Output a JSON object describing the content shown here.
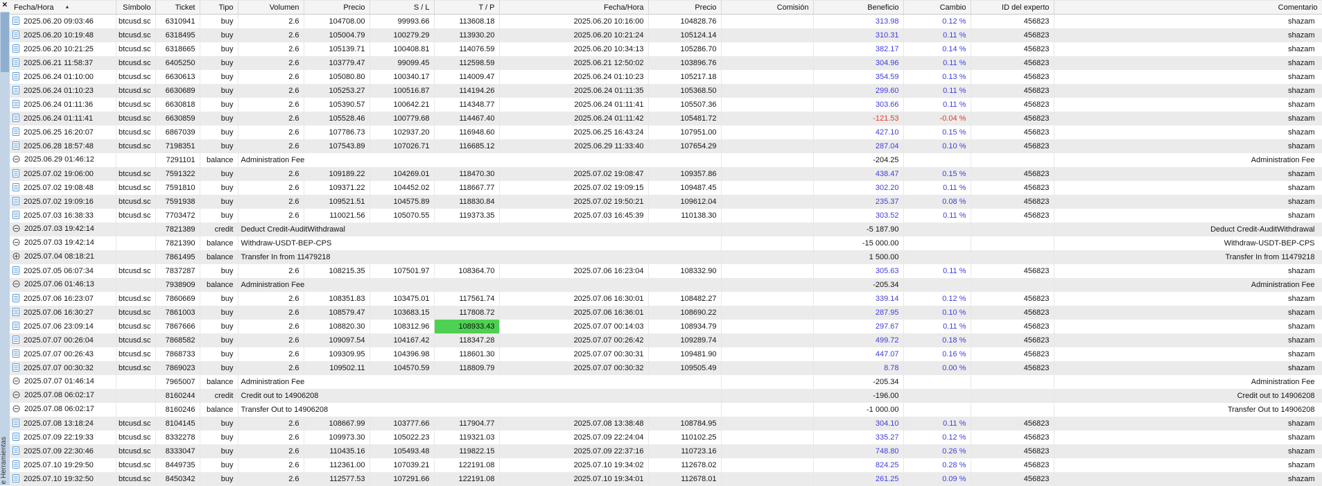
{
  "panel": {
    "close_glyph": "✕",
    "tab_label": "e Herramientas",
    "sort_glyph": "▲"
  },
  "colors": {
    "profit_positive": "#3e3edb",
    "profit_negative": "#e03a2a",
    "tp_highlight_bg": "#4ed152",
    "row_alt_bg": "#ebebeb"
  },
  "table": {
    "columns": [
      "Fecha/Hora",
      "Símbolo",
      "Ticket",
      "Tipo",
      "Volumen",
      "Precio",
      "S / L",
      "T / P",
      "Fecha/Hora",
      "Precio",
      "Comisión",
      "Beneficio",
      "Cambio",
      "ID del experto",
      "Comentario"
    ],
    "sort_column": "Fecha/Hora",
    "sort_direction": "asc",
    "row_fields": [
      "icon",
      "open_time",
      "symbol",
      "ticket",
      "type",
      "volume_or_description",
      "open_price",
      "sl",
      "tp",
      "close_time",
      "close_price",
      "commission",
      "profit",
      "change",
      "expert_id",
      "comment",
      "flag"
    ],
    "rows": [
      [
        "buy-order-icon",
        "2025.06.20 09:03:46",
        "btcusd.sc",
        "6310941",
        "buy",
        "2.6",
        "104708.00",
        "99993.66",
        "113608.18",
        "2025.06.20 10:16:00",
        "104828.76",
        "",
        "313.98",
        "0.12 %",
        "456823",
        "shazam",
        ""
      ],
      [
        "buy-order-icon",
        "2025.06.20 10:19:48",
        "btcusd.sc",
        "6318495",
        "buy",
        "2.6",
        "105004.79",
        "100279.29",
        "113930.20",
        "2025.06.20 10:21:24",
        "105124.14",
        "",
        "310.31",
        "0.11 %",
        "456823",
        "shazam",
        ""
      ],
      [
        "buy-order-icon",
        "2025.06.20 10:21:25",
        "btcusd.sc",
        "6318665",
        "buy",
        "2.6",
        "105139.71",
        "100408.81",
        "114076.59",
        "2025.06.20 10:34:13",
        "105286.70",
        "",
        "382.17",
        "0.14 %",
        "456823",
        "shazam",
        ""
      ],
      [
        "buy-order-icon",
        "2025.06.21 11:58:37",
        "btcusd.sc",
        "6405250",
        "buy",
        "2.6",
        "103779.47",
        "99099.45",
        "112598.59",
        "2025.06.21 12:50:02",
        "103896.76",
        "",
        "304.96",
        "0.11 %",
        "456823",
        "shazam",
        ""
      ],
      [
        "buy-order-icon",
        "2025.06.24 01:10:00",
        "btcusd.sc",
        "6630613",
        "buy",
        "2.6",
        "105080.80",
        "100340.17",
        "114009.47",
        "2025.06.24 01:10:23",
        "105217.18",
        "",
        "354.59",
        "0.13 %",
        "456823",
        "shazam",
        ""
      ],
      [
        "buy-order-icon",
        "2025.06.24 01:10:23",
        "btcusd.sc",
        "6630689",
        "buy",
        "2.6",
        "105253.27",
        "100516.87",
        "114194.26",
        "2025.06.24 01:11:35",
        "105368.50",
        "",
        "299.60",
        "0.11 %",
        "456823",
        "shazam",
        ""
      ],
      [
        "buy-order-icon",
        "2025.06.24 01:11:36",
        "btcusd.sc",
        "6630818",
        "buy",
        "2.6",
        "105390.57",
        "100642.21",
        "114348.77",
        "2025.06.24 01:11:41",
        "105507.36",
        "",
        "303.66",
        "0.11 %",
        "456823",
        "shazam",
        ""
      ],
      [
        "buy-order-icon",
        "2025.06.24 01:11:41",
        "btcusd.sc",
        "6630859",
        "buy",
        "2.6",
        "105528.46",
        "100779.68",
        "114467.40",
        "2025.06.24 01:11:42",
        "105481.72",
        "",
        "-121.53",
        "-0.04 %",
        "456823",
        "shazam",
        ""
      ],
      [
        "buy-order-icon",
        "2025.06.25 16:20:07",
        "btcusd.sc",
        "6867039",
        "buy",
        "2.6",
        "107786.73",
        "102937.20",
        "116948.60",
        "2025.06.25 16:43:24",
        "107951.00",
        "",
        "427.10",
        "0.15 %",
        "456823",
        "shazam",
        ""
      ],
      [
        "buy-order-icon",
        "2025.06.28 18:57:48",
        "btcusd.sc",
        "7198351",
        "buy",
        "2.6",
        "107543.89",
        "107026.71",
        "116685.12",
        "2025.06.29 11:33:40",
        "107654.29",
        "",
        "287.04",
        "0.10 %",
        "456823",
        "shazam",
        ""
      ],
      [
        "balance-minus-icon",
        "2025.06.29 01:46:12",
        "",
        "7291101",
        "balance",
        "Administration Fee",
        "",
        "",
        "",
        "",
        "",
        "",
        "-204.25",
        "",
        "",
        "Administration Fee",
        ""
      ],
      [
        "buy-order-icon",
        "2025.07.02 19:06:00",
        "btcusd.sc",
        "7591322",
        "buy",
        "2.6",
        "109189.22",
        "104269.01",
        "118470.30",
        "2025.07.02 19:08:47",
        "109357.86",
        "",
        "438.47",
        "0.15 %",
        "456823",
        "shazam",
        ""
      ],
      [
        "buy-order-icon",
        "2025.07.02 19:08:48",
        "btcusd.sc",
        "7591810",
        "buy",
        "2.6",
        "109371.22",
        "104452.02",
        "118667.77",
        "2025.07.02 19:09:15",
        "109487.45",
        "",
        "302.20",
        "0.11 %",
        "456823",
        "shazam",
        ""
      ],
      [
        "buy-order-icon",
        "2025.07.02 19:09:16",
        "btcusd.sc",
        "7591938",
        "buy",
        "2.6",
        "109521.51",
        "104575.89",
        "118830.84",
        "2025.07.02 19:50:21",
        "109612.04",
        "",
        "235.37",
        "0.08 %",
        "456823",
        "shazam",
        ""
      ],
      [
        "buy-order-icon",
        "2025.07.03 16:38:33",
        "btcusd.sc",
        "7703472",
        "buy",
        "2.6",
        "110021.56",
        "105070.55",
        "119373.35",
        "2025.07.03 16:45:39",
        "110138.30",
        "",
        "303.52",
        "0.11 %",
        "456823",
        "shazam",
        ""
      ],
      [
        "balance-minus-icon",
        "2025.07.03 19:42:14",
        "",
        "7821389",
        "credit",
        "Deduct Credit-AuditWithdrawal",
        "",
        "",
        "",
        "",
        "",
        "",
        "-5 187.90",
        "",
        "",
        "Deduct Credit-AuditWithdrawal",
        ""
      ],
      [
        "balance-minus-icon",
        "2025.07.03 19:42:14",
        "",
        "7821390",
        "balance",
        "Withdraw-USDT-BEP-CPS",
        "",
        "",
        "",
        "",
        "",
        "",
        "-15 000.00",
        "",
        "",
        "Withdraw-USDT-BEP-CPS",
        ""
      ],
      [
        "balance-plus-icon",
        "2025.07.04 08:18:21",
        "",
        "7861495",
        "balance",
        "Transfer In from 11479218",
        "",
        "",
        "",
        "",
        "",
        "",
        "1 500.00",
        "",
        "",
        "Transfer In from 11479218",
        ""
      ],
      [
        "buy-order-icon",
        "2025.07.05 06:07:34",
        "btcusd.sc",
        "7837287",
        "buy",
        "2.6",
        "108215.35",
        "107501.97",
        "108364.70",
        "2025.07.06 16:23:04",
        "108332.90",
        "",
        "305.63",
        "0.11 %",
        "456823",
        "shazam",
        ""
      ],
      [
        "balance-minus-icon",
        "2025.07.06 01:46:13",
        "",
        "7938909",
        "balance",
        "Administration Fee",
        "",
        "",
        "",
        "",
        "",
        "",
        "-205.34",
        "",
        "",
        "Administration Fee",
        ""
      ],
      [
        "buy-order-icon",
        "2025.07.06 16:23:07",
        "btcusd.sc",
        "7860669",
        "buy",
        "2.6",
        "108351.83",
        "103475.01",
        "117561.74",
        "2025.07.06 16:30:01",
        "108482.27",
        "",
        "339.14",
        "0.12 %",
        "456823",
        "shazam",
        ""
      ],
      [
        "buy-order-icon",
        "2025.07.06 16:30:27",
        "btcusd.sc",
        "7861003",
        "buy",
        "2.6",
        "108579.47",
        "103683.15",
        "117808.72",
        "2025.07.06 16:36:01",
        "108690.22",
        "",
        "287.95",
        "0.10 %",
        "456823",
        "shazam",
        ""
      ],
      [
        "buy-order-icon",
        "2025.07.06 23:09:14",
        "btcusd.sc",
        "7867666",
        "buy",
        "2.6",
        "108820.30",
        "108312.96",
        "108933.43",
        "2025.07.07 00:14:03",
        "108934.79",
        "",
        "297.67",
        "0.11 %",
        "456823",
        "shazam",
        "tp-highlight"
      ],
      [
        "buy-order-icon",
        "2025.07.07 00:26:04",
        "btcusd.sc",
        "7868582",
        "buy",
        "2.6",
        "109097.54",
        "104167.42",
        "118347.28",
        "2025.07.07 00:26:42",
        "109289.74",
        "",
        "499.72",
        "0.18 %",
        "456823",
        "shazam",
        ""
      ],
      [
        "buy-order-icon",
        "2025.07.07 00:26:43",
        "btcusd.sc",
        "7868733",
        "buy",
        "2.6",
        "109309.95",
        "104396.98",
        "118601.30",
        "2025.07.07 00:30:31",
        "109481.90",
        "",
        "447.07",
        "0.16 %",
        "456823",
        "shazam",
        ""
      ],
      [
        "buy-order-icon",
        "2025.07.07 00:30:32",
        "btcusd.sc",
        "7869023",
        "buy",
        "2.6",
        "109502.11",
        "104570.59",
        "118809.79",
        "2025.07.07 00:30:32",
        "109505.49",
        "",
        "8.78",
        "0.00 %",
        "456823",
        "shazam",
        ""
      ],
      [
        "balance-minus-icon",
        "2025.07.07 01:46:14",
        "",
        "7965007",
        "balance",
        "Administration Fee",
        "",
        "",
        "",
        "",
        "",
        "",
        "-205.34",
        "",
        "",
        "Administration Fee",
        ""
      ],
      [
        "balance-minus-icon",
        "2025.07.08 06:02:17",
        "",
        "8160244",
        "credit",
        "Credit out to 14906208",
        "",
        "",
        "",
        "",
        "",
        "",
        "-196.00",
        "",
        "",
        "Credit out to 14906208",
        ""
      ],
      [
        "balance-minus-icon",
        "2025.07.08 06:02:17",
        "",
        "8160246",
        "balance",
        "Transfer Out to 14906208",
        "",
        "",
        "",
        "",
        "",
        "",
        "-1 000.00",
        "",
        "",
        "Transfer Out to 14906208",
        ""
      ],
      [
        "buy-order-icon",
        "2025.07.08 13:18:24",
        "btcusd.sc",
        "8104145",
        "buy",
        "2.6",
        "108667.99",
        "103777.66",
        "117904.77",
        "2025.07.08 13:38:48",
        "108784.95",
        "",
        "304.10",
        "0.11 %",
        "456823",
        "shazam",
        ""
      ],
      [
        "buy-order-icon",
        "2025.07.09 22:19:33",
        "btcusd.sc",
        "8332278",
        "buy",
        "2.6",
        "109973.30",
        "105022.23",
        "119321.03",
        "2025.07.09 22:24:04",
        "110102.25",
        "",
        "335.27",
        "0.12 %",
        "456823",
        "shazam",
        ""
      ],
      [
        "buy-order-icon",
        "2025.07.09 22:30:46",
        "btcusd.sc",
        "8333047",
        "buy",
        "2.6",
        "110435.16",
        "105493.48",
        "119822.15",
        "2025.07.09 22:37:16",
        "110723.16",
        "",
        "748.80",
        "0.26 %",
        "456823",
        "shazam",
        ""
      ],
      [
        "buy-order-icon",
        "2025.07.10 19:29:50",
        "btcusd.sc",
        "8449735",
        "buy",
        "2.6",
        "112361.00",
        "107039.21",
        "122191.08",
        "2025.07.10 19:34:02",
        "112678.02",
        "",
        "824.25",
        "0.28 %",
        "456823",
        "shazam",
        ""
      ],
      [
        "buy-order-icon",
        "2025.07.10 19:32:50",
        "btcusd.sc",
        "8450342",
        "buy",
        "2.6",
        "112577.53",
        "107291.66",
        "122191.08",
        "2025.07.10 19:34:01",
        "112678.01",
        "",
        "261.25",
        "0.09 %",
        "456823",
        "shazam",
        ""
      ]
    ]
  }
}
